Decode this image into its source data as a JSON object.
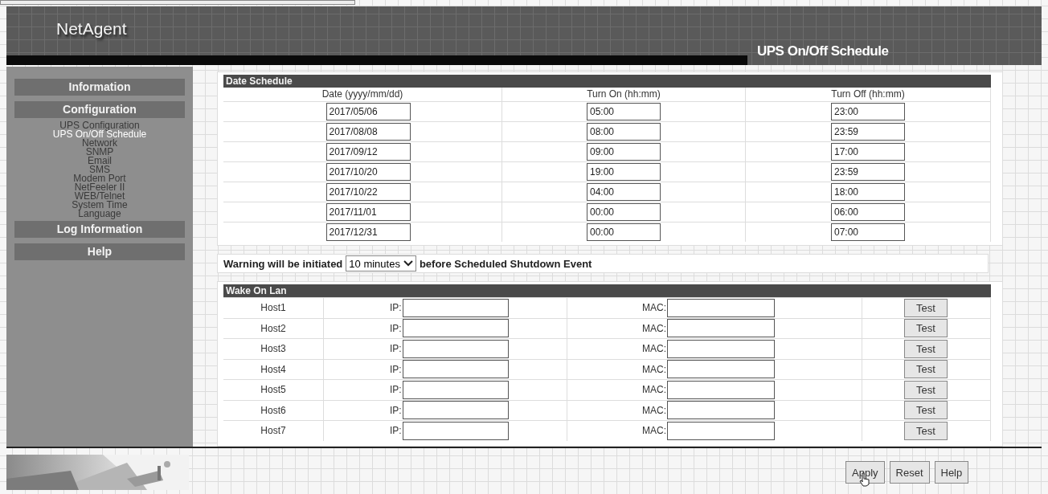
{
  "header": {
    "logo": "NetAgent",
    "page_title": "UPS On/Off Schedule"
  },
  "sidebar": {
    "items": [
      {
        "kind": "section",
        "label": "Information",
        "selected": false
      },
      {
        "kind": "section",
        "label": "Configuration",
        "selected": false
      },
      {
        "kind": "link",
        "label": "UPS Configuration",
        "selected": false
      },
      {
        "kind": "link",
        "label": "UPS On/Off Schedule",
        "selected": true
      },
      {
        "kind": "link",
        "label": "Network",
        "selected": false
      },
      {
        "kind": "link",
        "label": "SNMP",
        "selected": false
      },
      {
        "kind": "link",
        "label": "Email",
        "selected": false
      },
      {
        "kind": "link",
        "label": "SMS",
        "selected": false
      },
      {
        "kind": "link",
        "label": "Modem Port",
        "selected": false
      },
      {
        "kind": "link",
        "label": "NetFeeler II",
        "selected": false
      },
      {
        "kind": "link",
        "label": "WEB/Telnet",
        "selected": false
      },
      {
        "kind": "link",
        "label": "System Time",
        "selected": false
      },
      {
        "kind": "link",
        "label": "Language",
        "selected": false
      },
      {
        "kind": "section",
        "label": "Log Information",
        "selected": false
      },
      {
        "kind": "section",
        "label": "Help",
        "selected": false
      }
    ]
  },
  "date_schedule": {
    "title": "Date Schedule",
    "columns": [
      "Date (yyyy/mm/dd)",
      "Turn On (hh:mm)",
      "Turn Off (hh:mm)"
    ],
    "rows": [
      {
        "date": "2017/05/06",
        "turn_on": "05:00",
        "turn_off": "23:00"
      },
      {
        "date": "2017/08/08",
        "turn_on": "08:00",
        "turn_off": "23:59"
      },
      {
        "date": "2017/09/12",
        "turn_on": "09:00",
        "turn_off": "17:00"
      },
      {
        "date": "2017/10/20",
        "turn_on": "19:00",
        "turn_off": "23:59"
      },
      {
        "date": "2017/10/22",
        "turn_on": "04:00",
        "turn_off": "18:00"
      },
      {
        "date": "2017/11/01",
        "turn_on": "00:00",
        "turn_off": "06:00"
      },
      {
        "date": "2017/12/31",
        "turn_on": "00:00",
        "turn_off": "07:00"
      }
    ]
  },
  "warning": {
    "before": "Warning will be initiated",
    "select": "10 minutes",
    "after": "before Scheduled Shutdown Event"
  },
  "wake_on_lan": {
    "title": "Wake On Lan",
    "rows": [
      {
        "host": "Host1",
        "ip_label": "IP:",
        "mac_label": "MAC:",
        "button": "Test"
      },
      {
        "host": "Host2",
        "ip_label": "IP:",
        "mac_label": "MAC:",
        "button": "Test"
      },
      {
        "host": "Host3",
        "ip_label": "IP:",
        "mac_label": "MAC:",
        "button": "Test"
      },
      {
        "host": "Host4",
        "ip_label": "IP:",
        "mac_label": "MAC:",
        "button": "Test"
      },
      {
        "host": "Host5",
        "ip_label": "IP:",
        "mac_label": "MAC:",
        "button": "Test"
      },
      {
        "host": "Host6",
        "ip_label": "IP:",
        "mac_label": "MAC:",
        "button": "Test"
      },
      {
        "host": "Host7",
        "ip_label": "IP:",
        "mac_label": "MAC:",
        "button": "Test"
      }
    ]
  },
  "footer": {
    "buttons": [
      "Apply",
      "Reset",
      "Help"
    ]
  }
}
